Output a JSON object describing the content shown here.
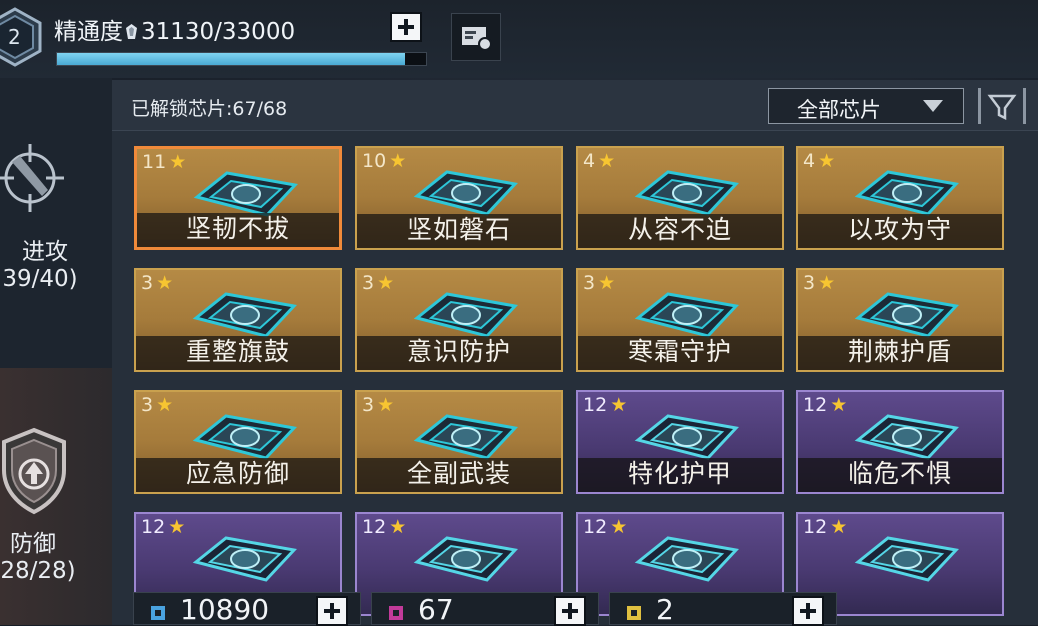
{
  "header": {
    "mastery_label": "精通度",
    "mastery_value": "31130/33000",
    "mastery_progress": 0.943
  },
  "sidebar": {
    "tabs": [
      {
        "label": "进攻",
        "count": "39/40)",
        "icon": "crosshair-missile-icon"
      },
      {
        "label": "防御",
        "count": "28/28)",
        "icon": "shield-arrow-icon"
      }
    ]
  },
  "panel": {
    "unlocked_text": "已解锁芯片:67/68",
    "filter_label": "全部芯片"
  },
  "cards": [
    {
      "level": "11",
      "name": "坚韧不拔",
      "rarity": "gold",
      "selected": true
    },
    {
      "level": "10",
      "name": "坚如磐石",
      "rarity": "gold"
    },
    {
      "level": "4",
      "name": "从容不迫",
      "rarity": "gold"
    },
    {
      "level": "4",
      "name": "以攻为守",
      "rarity": "gold"
    },
    {
      "level": "3",
      "name": "重整旗鼓",
      "rarity": "gold"
    },
    {
      "level": "3",
      "name": "意识防护",
      "rarity": "gold"
    },
    {
      "level": "3",
      "name": "寒霜守护",
      "rarity": "gold"
    },
    {
      "level": "3",
      "name": "荆棘护盾",
      "rarity": "gold"
    },
    {
      "level": "3",
      "name": "应急防御",
      "rarity": "gold"
    },
    {
      "level": "3",
      "name": "全副武装",
      "rarity": "gold"
    },
    {
      "level": "12",
      "name": "特化护甲",
      "rarity": "purple"
    },
    {
      "level": "12",
      "name": "临危不惧",
      "rarity": "purple"
    },
    {
      "level": "12",
      "name": "",
      "rarity": "purple"
    },
    {
      "level": "12",
      "name": "",
      "rarity": "purple"
    },
    {
      "level": "12",
      "name": "",
      "rarity": "purple"
    },
    {
      "level": "12",
      "name": "",
      "rarity": "purple"
    }
  ],
  "resources": [
    {
      "value": "10890",
      "color": "#4aa3e0"
    },
    {
      "value": "67",
      "color": "#c23b9a"
    },
    {
      "value": "2",
      "color": "#e0c040"
    }
  ],
  "colors": {
    "accent": "#f08a3a",
    "gold": "#c9a14e",
    "purple": "#9b86d0",
    "star": "#f7c531"
  }
}
